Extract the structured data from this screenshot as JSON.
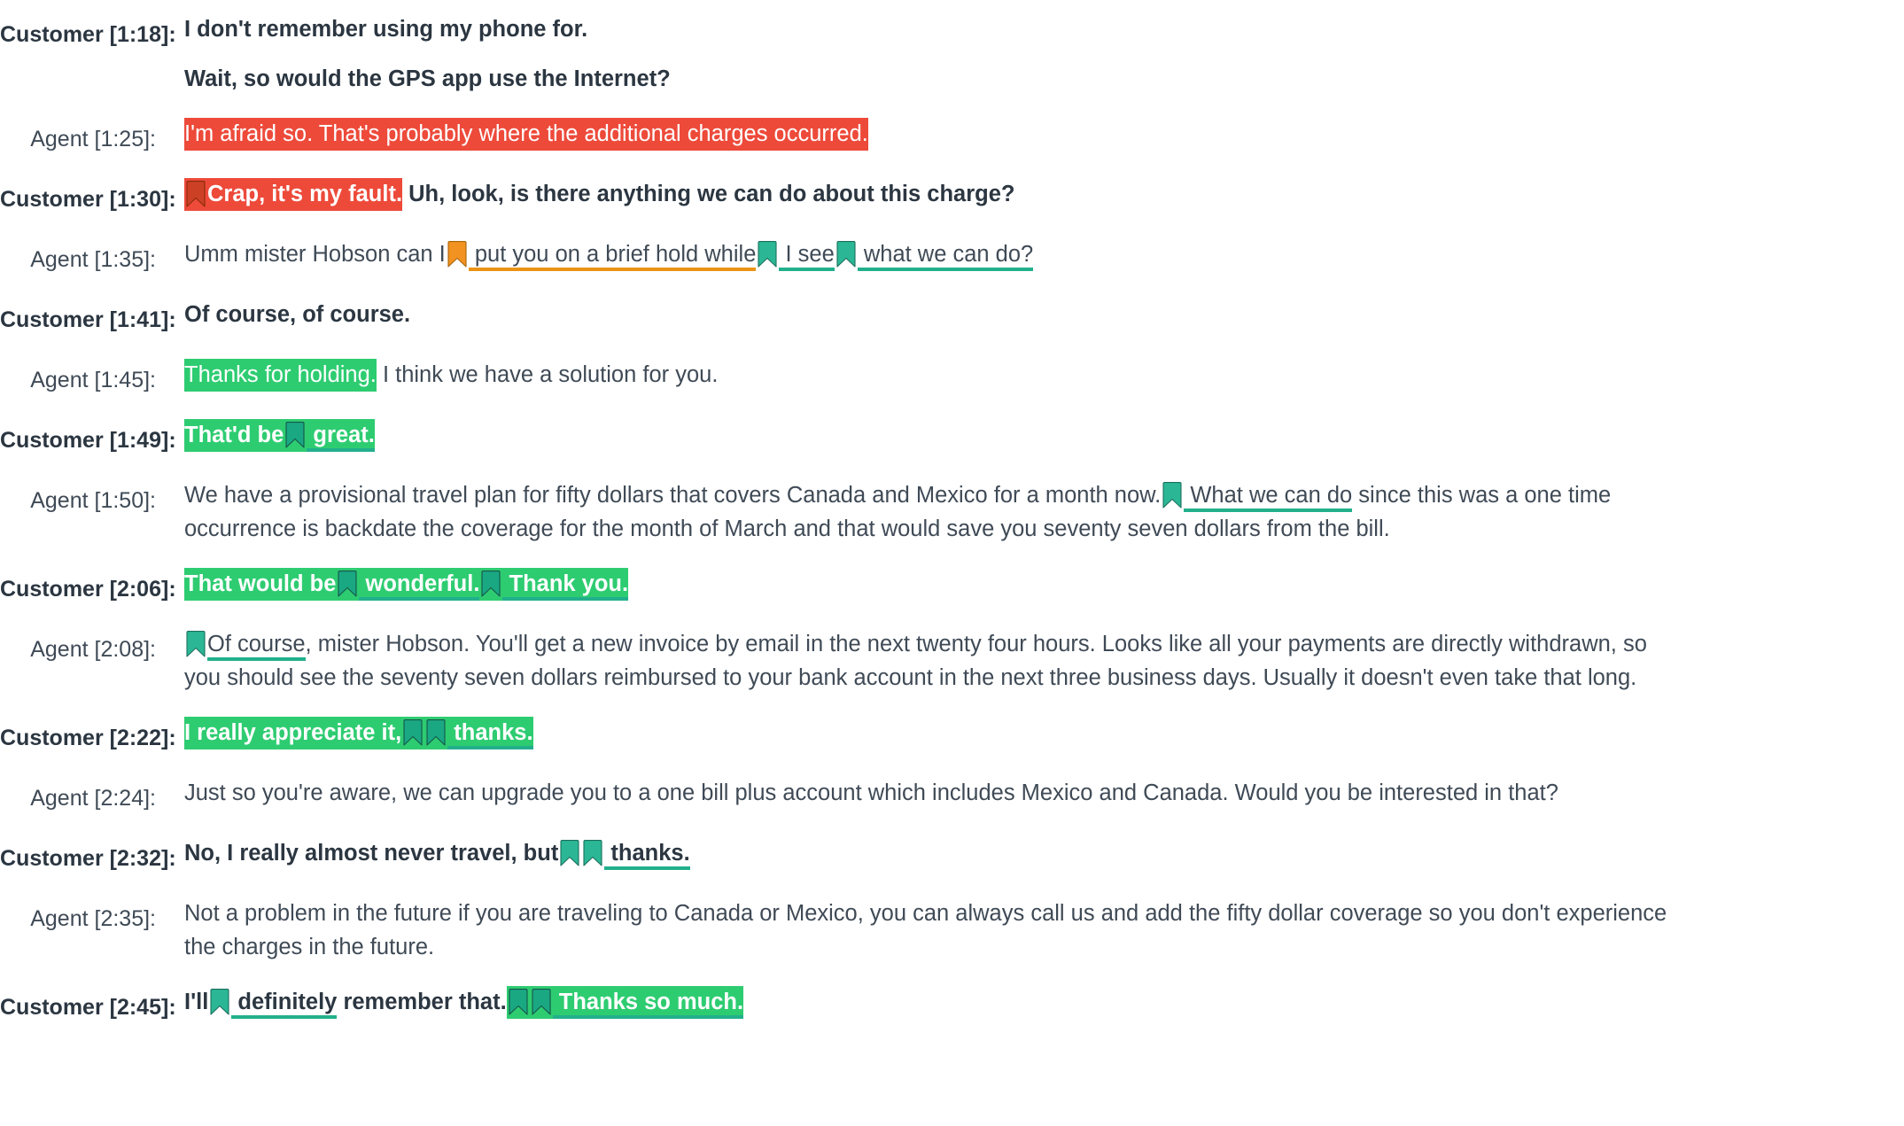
{
  "colors": {
    "highlight_negative": "#ed4a3a",
    "highlight_positive": "#2ecc71",
    "bookmark_teal": "#2bb795",
    "bookmark_teal_dark": "#1aa883",
    "bookmark_orange": "#f29220",
    "bookmark_darkred": "#cc4125",
    "underline_teal": "#22b08c",
    "underline_orange": "#eb9316",
    "underline_darkred": "#c0450f",
    "text": "#2b3641",
    "background": "#ffffff"
  },
  "turns": [
    {
      "speaker": "Customer [1:18]:",
      "role": "customer",
      "paragraphs": [
        {
          "segments": [
            {
              "text": "I don't remember using my phone for."
            }
          ]
        },
        {
          "segments": [
            {
              "text": "Wait, so would the GPS app use the Internet?"
            }
          ]
        }
      ]
    },
    {
      "speaker": "Agent [1:25]:",
      "role": "agent",
      "paragraphs": [
        {
          "segments": [
            {
              "text": "I'm afraid so. That's probably where the additional charges occurred.",
              "style": "hl-red"
            }
          ]
        }
      ]
    },
    {
      "speaker": "Customer [1:30]:",
      "role": "customer",
      "paragraphs": [
        {
          "segments": [
            {
              "bookmark": "darkred",
              "on_highlight": "hl-red"
            },
            {
              "text": "Crap, it's my fault.",
              "style": "hl-red"
            },
            {
              "text": " Uh, look, is there anything we can do about this charge?"
            }
          ]
        }
      ]
    },
    {
      "speaker": "Agent [1:35]:",
      "role": "agent",
      "paragraphs": [
        {
          "segments": [
            {
              "text": "Umm mister Hobson can I"
            },
            {
              "bookmark": "orange"
            },
            {
              "text": " put you on a brief hold while",
              "underline": "ul-orange"
            },
            {
              "bookmark": "teal"
            },
            {
              "text": " I see",
              "underline": "ul-teal"
            },
            {
              "bookmark": "teal"
            },
            {
              "text": " what we can do?",
              "underline": "ul-teal"
            }
          ]
        }
      ]
    },
    {
      "speaker": "Customer [1:41]:",
      "role": "customer",
      "paragraphs": [
        {
          "segments": [
            {
              "text": "Of course, of course."
            }
          ]
        }
      ]
    },
    {
      "speaker": "Agent [1:45]:",
      "role": "agent",
      "paragraphs": [
        {
          "segments": [
            {
              "text": "Thanks for holding.",
              "style": "hl-green"
            },
            {
              "text": " I think we have a solution for you."
            }
          ]
        }
      ]
    },
    {
      "speaker": "Customer [1:49]:",
      "role": "customer",
      "paragraphs": [
        {
          "segments": [
            {
              "text": "That'd be",
              "style": "hl-green"
            },
            {
              "bookmark": "teal-dark",
              "on_highlight": "hl-green"
            },
            {
              "text": " great.",
              "style": "hl-green",
              "underline": "ul-teal"
            }
          ]
        }
      ]
    },
    {
      "speaker": "Agent [1:50]:",
      "role": "agent",
      "paragraphs": [
        {
          "segments": [
            {
              "text": "We have a provisional travel plan for fifty dollars that covers Canada and Mexico for a month now."
            },
            {
              "bookmark": "teal"
            },
            {
              "text": " What we can do",
              "underline": "ul-teal"
            },
            {
              "text": " since this was a one time occurrence is backdate the coverage for the month of March and that would save you seventy seven dollars from the bill."
            }
          ]
        }
      ]
    },
    {
      "speaker": "Customer [2:06]:",
      "role": "customer",
      "paragraphs": [
        {
          "segments": [
            {
              "text": "That would be",
              "style": "hl-green"
            },
            {
              "bookmark": "teal-dark",
              "on_highlight": "hl-green"
            },
            {
              "text": " wonderful.",
              "style": "hl-green",
              "underline": "ul-teal"
            },
            {
              "bookmark": "teal-dark",
              "on_highlight": "hl-green"
            },
            {
              "text": " Thank you.",
              "style": "hl-green",
              "underline": "ul-teal"
            }
          ]
        }
      ]
    },
    {
      "speaker": "Agent [2:08]:",
      "role": "agent",
      "paragraphs": [
        {
          "segments": [
            {
              "bookmark": "teal"
            },
            {
              "text": "Of course",
              "underline": "ul-teal"
            },
            {
              "text": ", mister Hobson. You'll get a new invoice by email in the next twenty four hours. Looks like all your payments are directly withdrawn, so you should see the seventy seven dollars reimbursed to your bank account in the next three business days. Usually it doesn't even take that long."
            }
          ]
        }
      ]
    },
    {
      "speaker": "Customer [2:22]:",
      "role": "customer",
      "paragraphs": [
        {
          "segments": [
            {
              "text": "I really appreciate it,",
              "style": "hl-green"
            },
            {
              "bookmark": "teal-dark",
              "on_highlight": "hl-green"
            },
            {
              "bookmark": "teal-dark",
              "on_highlight": "hl-green"
            },
            {
              "text": " thanks.",
              "style": "hl-green",
              "underline": "ul-teal"
            }
          ]
        }
      ]
    },
    {
      "speaker": "Agent [2:24]:",
      "role": "agent",
      "paragraphs": [
        {
          "segments": [
            {
              "text": "Just so you're aware, we can upgrade you to a one bill plus account which includes Mexico and Canada. Would you be interested in that?"
            }
          ]
        }
      ]
    },
    {
      "speaker": "Customer [2:32]:",
      "role": "customer",
      "paragraphs": [
        {
          "segments": [
            {
              "text": "No, I really almost never travel, but"
            },
            {
              "bookmark": "teal"
            },
            {
              "bookmark": "teal"
            },
            {
              "text": " thanks.",
              "underline": "ul-teal"
            }
          ]
        }
      ]
    },
    {
      "speaker": "Agent [2:35]:",
      "role": "agent",
      "paragraphs": [
        {
          "segments": [
            {
              "text": "Not a problem in the future if you are traveling to Canada or Mexico, you can always call us and add the fifty dollar coverage so you don't experience the charges in the future."
            }
          ]
        }
      ]
    },
    {
      "speaker": "Customer [2:45]:",
      "role": "customer",
      "paragraphs": [
        {
          "segments": [
            {
              "text": "I'll"
            },
            {
              "bookmark": "teal"
            },
            {
              "text": " definitely",
              "underline": "ul-teal"
            },
            {
              "text": " remember that."
            },
            {
              "bookmark": "teal-dark",
              "on_highlight": "hl-green"
            },
            {
              "bookmark": "teal-dark",
              "on_highlight": "hl-green"
            },
            {
              "text": " Thanks so much.",
              "style": "hl-green",
              "underline": "ul-teal"
            }
          ]
        }
      ]
    }
  ]
}
